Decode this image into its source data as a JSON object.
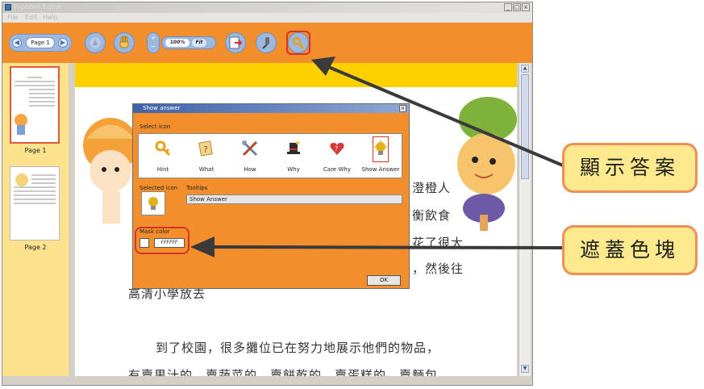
{
  "window": {
    "title": "Flipbook Editor",
    "controls": {
      "minimize": "_",
      "maximize": "□",
      "close": "×"
    }
  },
  "menubar": {
    "items": [
      "File",
      "Edit",
      "Help"
    ]
  },
  "toolbar": {
    "page_field": "Page 1",
    "zoom_value": "100%",
    "fit_label": "Fit",
    "zoom_plus": "+",
    "zoom_minus": "−",
    "prev_arrow": "◀",
    "next_arrow": "▶",
    "icons": [
      "hand-icon",
      "pan-icon",
      "export-icon",
      "microphone-icon",
      "key-icon"
    ]
  },
  "sidebar": {
    "pages": [
      {
        "label": "Page 1",
        "selected": true
      },
      {
        "label": "Page 2",
        "selected": false
      }
    ]
  },
  "document": {
    "text_lines": [
      "澄橙人",
      "衡飲食",
      "花了很大",
      "，然後往",
      "高清小學放去",
      "到了校園，很多攤位已在努力地展示他們的物品，",
      "有賣果汁的、賣蔬菜的、賣餅乾的、賣蛋糕的、賣麵包"
    ]
  },
  "dialog": {
    "title": "Show answer",
    "select_icon_label": "Select icon",
    "icons": [
      {
        "label": "Hint",
        "icon": "key-icon",
        "color": "#e5a11a"
      },
      {
        "label": "What",
        "icon": "question-card-icon",
        "color": "#e89a2c"
      },
      {
        "label": "How",
        "icon": "tools-icon",
        "color": "#6c7fa0"
      },
      {
        "label": "Why",
        "icon": "magic-hat-icon",
        "color": "#2b2b2b"
      },
      {
        "label": "Care Why",
        "icon": "heart-question-icon",
        "color": "#d13a3a"
      },
      {
        "label": "Show Answer",
        "icon": "lightbulb-icon",
        "color": "#e3b21a",
        "selected": true
      }
    ],
    "selected_icon_label": "Selected icon",
    "tooltips_label": "Tooltips",
    "tooltips_value": "Show Answer",
    "mask_color_label": "Mask color",
    "mask_color_value": "FFFFFF",
    "ok_label": "OK",
    "close": "×"
  },
  "callouts": {
    "show_answer": "顯示答案",
    "mask_block": "遮蓋色塊"
  },
  "colors": {
    "toolbar_orange": "#f28e2b",
    "sidebar_yellow": "#fde28d",
    "highlight_red": "#d5332b",
    "callout_fill": "#fde98e",
    "callout_border": "#ef8f55"
  }
}
